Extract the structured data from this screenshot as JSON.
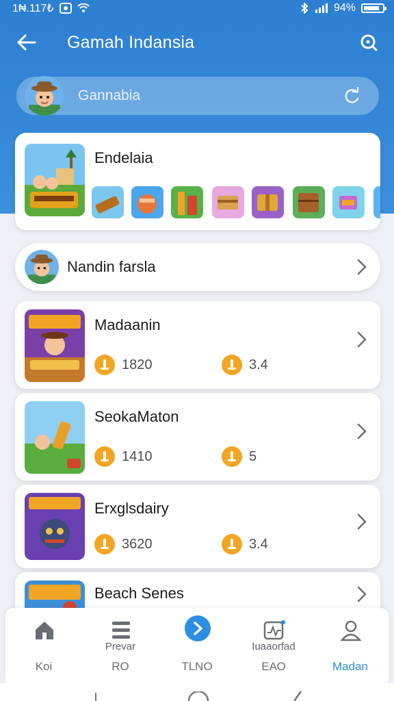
{
  "status_bar": {
    "time": "1₦.117₺",
    "battery": "94%"
  },
  "appbar": {
    "title": "Gamah Indansia"
  },
  "search": {
    "text": "Gannabia"
  },
  "featured": {
    "name": "Endelaia"
  },
  "profile_row": {
    "name": "Nandin farsla"
  },
  "games": [
    {
      "name": "Madaanin",
      "stat1": "1820",
      "stat2": "3.4"
    },
    {
      "name": "SeokaMaton",
      "stat1": "1410",
      "stat2": "5"
    },
    {
      "name": "Erxglsdairy",
      "stat1": "3620",
      "stat2": "3.4"
    },
    {
      "name": "Beach Senes"
    }
  ],
  "tabs": [
    {
      "label": "Koi",
      "sub": "",
      "icon": "home-icon"
    },
    {
      "label": "RO",
      "sub": "Prevar",
      "icon": "menu-list-icon"
    },
    {
      "label": "TLNO",
      "sub": "",
      "icon": "play-icon"
    },
    {
      "label": "ЕАО",
      "sub": "Iuaaorfad",
      "icon": "activity-icon"
    },
    {
      "label": "Madan",
      "sub": "",
      "icon": "person-icon"
    }
  ],
  "colors": {
    "primary": "#2d7fd1",
    "accent": "#2b8ee0",
    "coin": "#f0a624"
  }
}
